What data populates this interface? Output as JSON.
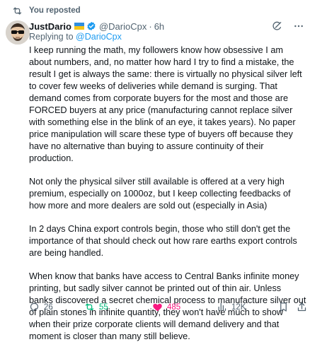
{
  "repost": {
    "label": "You reposted"
  },
  "author": {
    "name": "JustDario",
    "handle": "@DarioCpx",
    "separator": "·",
    "time": "6h"
  },
  "reply_to": {
    "prefix": "Replying to",
    "mention": "@DarioCpx"
  },
  "tweet": {
    "paragraphs": [
      "I keep running the math, my followers know how obsessive I am about numbers, and, no matter how hard I try to find a mistake, the result I get is always the same: there is virtually no physical silver left to cover few weeks of deliveries while demand is surging. That demand comes from corporate buyers for the most and those are FORCED buyers at any price (manufacturing cannot replace silver with something else in the blink of an eye, it takes years). No paper price manipulation will scare these type of buyers off because they have no alternative than buying to assure continuity of their production.",
      "Not only the physical silver still available is offered at a very high premium, especially on 1000oz, but I keep collecting feedbacks of how more and more dealers are sold out (especially in Asia)",
      "In 2 days China export controls begin, those who still don't get the importance of that should check out how rare earths export controls are being handled.",
      "When know that banks have access to Central Banks infinite money printing, but sadly silver cannot be printed out of thin air. Unless banks discovered a secret chemical process to manufacture silver out of plain stones in infinite quantity, they won't have much to show when their prize corporate clients will demand delivery and that moment is closer than many still believe."
    ]
  },
  "actions": {
    "replies": "26",
    "reposts": "55",
    "likes": "485",
    "views": "12K"
  },
  "colors": {
    "repost_active": "#00ba7c",
    "like_active": "#f91880",
    "link": "#1d9bf0",
    "muted": "#536471"
  }
}
